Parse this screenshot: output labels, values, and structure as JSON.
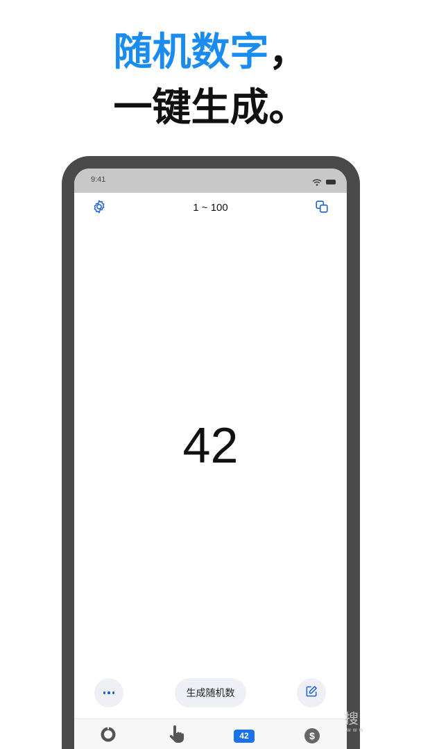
{
  "headline": {
    "line1_blue": "随机数字",
    "line1_punct": "，",
    "line2": "一键生成。"
  },
  "status_bar": {
    "time": "9:41",
    "icons": [
      "wifi-icon",
      "battery-icon"
    ]
  },
  "toolbar": {
    "left_icon": "gear-icon",
    "range_label": "1 ~ 100",
    "right_icon": "copy-icon"
  },
  "result": {
    "value": "42"
  },
  "actions": {
    "more_icon": "ellipsis-icon",
    "generate_label": "生成随机数",
    "edit_icon": "edit-icon"
  },
  "bottom_nav": {
    "items": [
      {
        "icon": "dial-icon"
      },
      {
        "icon": "tap-hand-icon"
      },
      {
        "icon": "number-badge-icon",
        "label": "42",
        "active": true
      },
      {
        "icon": "dollar-coin-icon",
        "label": "$"
      }
    ]
  },
  "watermark": {
    "glyph": "搜",
    "sub": "www"
  },
  "colors": {
    "accent_blue": "#1a8cf0",
    "icon_blue": "#1a5fd8",
    "active_badge": "#1a73e8",
    "device_frame": "#4a4a4a",
    "status_bar": "#c8c8c8",
    "button_bg": "#eef0f6"
  }
}
